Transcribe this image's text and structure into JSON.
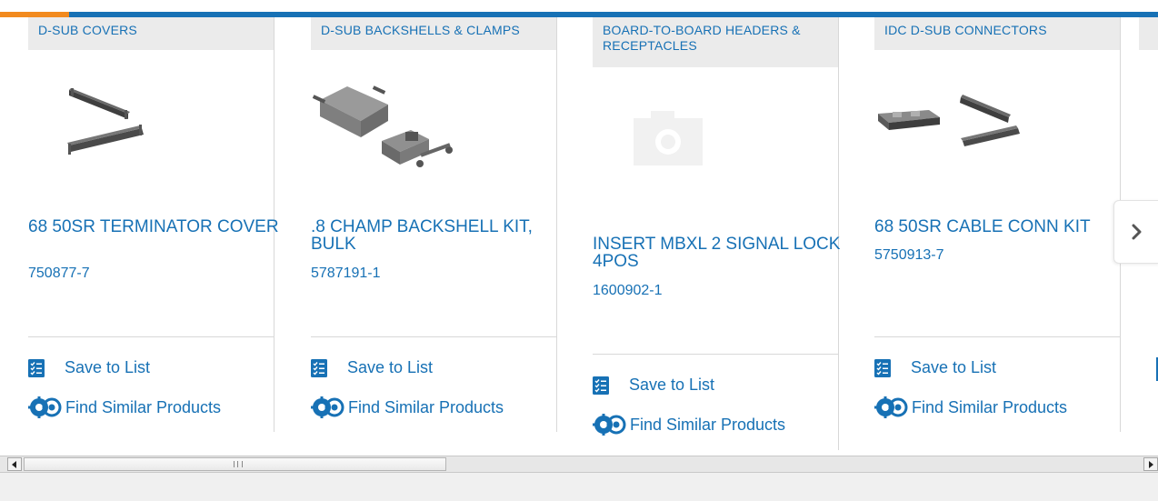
{
  "carousel": {
    "progress_fraction": 0.06,
    "next_arrow_glyph": "›",
    "products": [
      {
        "category": "D-SUB COVERS",
        "title": "68 50SR TERMINATOR COVER",
        "part_number": "750877-7",
        "save_label": "Save to List",
        "similar_label": "Find Similar Products",
        "image": "connector-pair-image"
      },
      {
        "category": "D-SUB BACKSHELLS & CLAMPS",
        "title": ".8 CHAMP BACKSHELL KIT, BULK",
        "part_number": "5787191-1",
        "save_label": "Save to List",
        "similar_label": "Find Similar Products",
        "image": "backshell-kit-image"
      },
      {
        "category": "BOARD-TO-BOARD HEADERS & RECEPTACLES",
        "title": "INSERT MBXL 2 SIGNAL LOCK 4POS",
        "part_number": "1600902-1",
        "save_label": "Save to List",
        "similar_label": "Find Similar Products",
        "image": "camera-placeholder-icon"
      },
      {
        "category": "IDC D-SUB CONNECTORS",
        "title": "68 50SR CABLE CONN KIT",
        "part_number": "5750913-7",
        "save_label": "Save to List",
        "similar_label": "Find Similar Products",
        "image": "cable-conn-kit-image"
      }
    ]
  },
  "colors": {
    "link_blue": "#1771b5",
    "accent_orange": "#f28a1e",
    "category_bg": "#ebebeb"
  },
  "scrollbar": {
    "left_arrow": "◀",
    "right_arrow": "▶"
  }
}
